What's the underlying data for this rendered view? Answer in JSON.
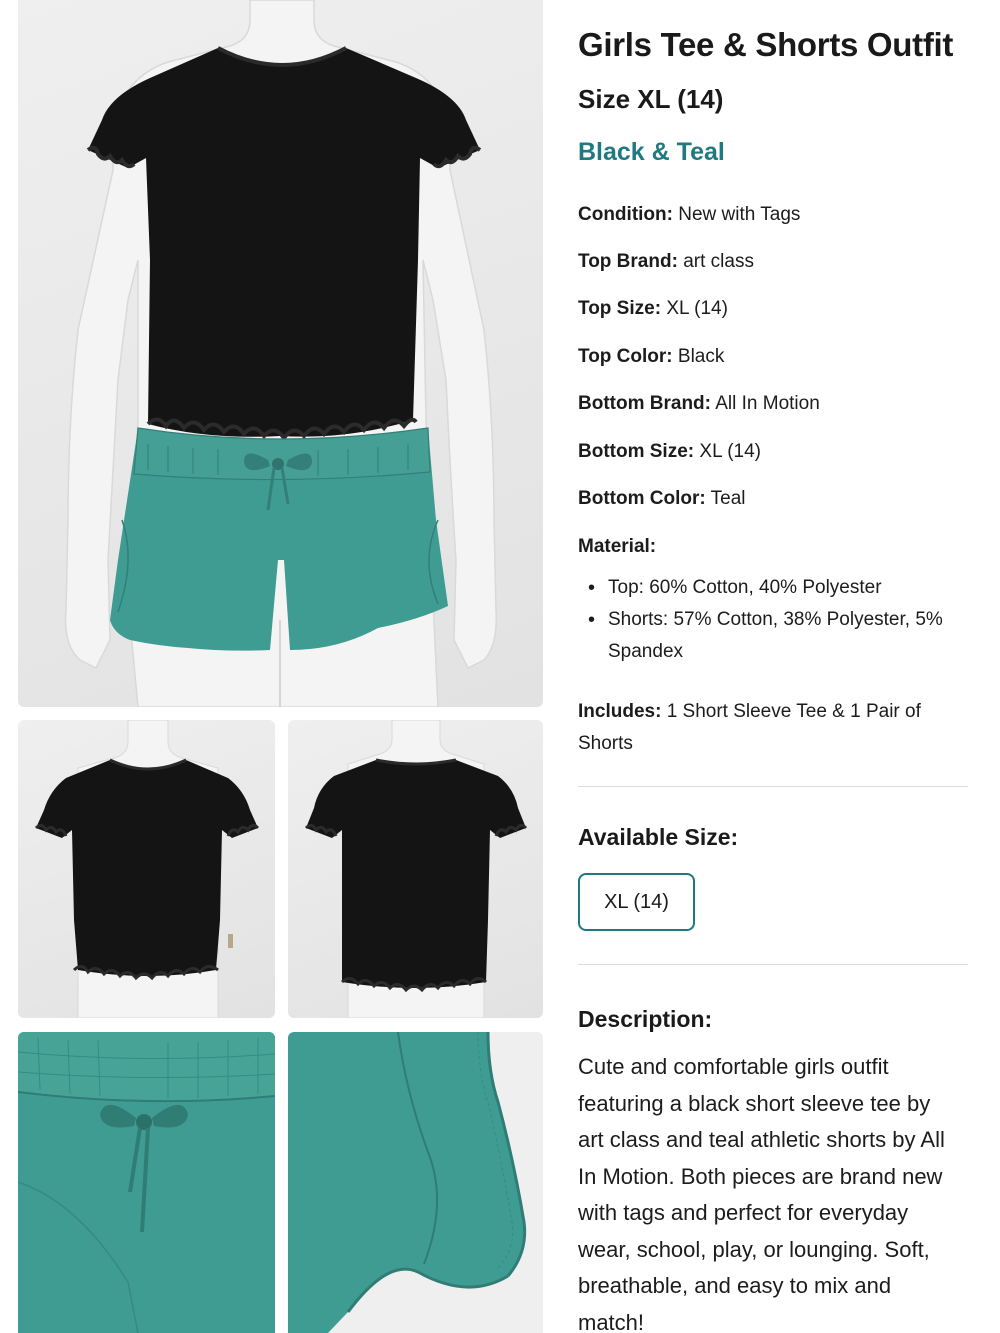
{
  "product": {
    "title": "Girls Tee & Shorts Outfit",
    "size_line": "Size XL (14)",
    "color_line": "Black & Teal"
  },
  "specs": [
    {
      "label": "Condition:",
      "value": "New with Tags"
    },
    {
      "label": "Top Brand:",
      "value": "art class"
    },
    {
      "label": "Top Size:",
      "value": "XL (14)"
    },
    {
      "label": "Top Color:",
      "value": "Black"
    },
    {
      "label": "Bottom Brand:",
      "value": "All In Motion"
    },
    {
      "label": "Bottom Size:",
      "value": "XL (14)"
    },
    {
      "label": "Bottom Color:",
      "value": "Teal"
    }
  ],
  "material": {
    "label": "Material:",
    "items": [
      "Top: 60% Cotton, 40% Polyester",
      "Shorts: 57% Cotton, 38% Polyester, 5% Spandex"
    ]
  },
  "includes": {
    "label": "Includes:",
    "value": "1 Short Sleeve Tee & 1 Pair of Shorts"
  },
  "available_sizes": {
    "heading": "Available Size:",
    "options": [
      "XL (14)"
    ],
    "selected": "XL (14)"
  },
  "description": {
    "heading": "Description:",
    "text": "Cute and comfortable girls outfit featuring a black short sleeve tee by art class and teal athletic shorts by All In Motion. Both pieces are brand new with tags and perfect for everyday wear, school, play, or lounging. Soft, breathable, and easy to mix and match!"
  },
  "colors": {
    "accent": "#1f7a80",
    "tee": "#141414",
    "shorts": "#3f9c92",
    "mannequin": "#f4f4f4",
    "photo_bg": "#e6e6e6"
  },
  "photos": [
    {
      "name": "main-outfit-photo",
      "icon": "mannequin-outfit-front"
    },
    {
      "name": "tee-front-photo",
      "icon": "tee-front"
    },
    {
      "name": "tee-back-photo",
      "icon": "tee-back"
    },
    {
      "name": "shorts-waistband-photo",
      "icon": "shorts-bow-closeup"
    },
    {
      "name": "shorts-hem-photo",
      "icon": "shorts-hem-closeup"
    }
  ]
}
